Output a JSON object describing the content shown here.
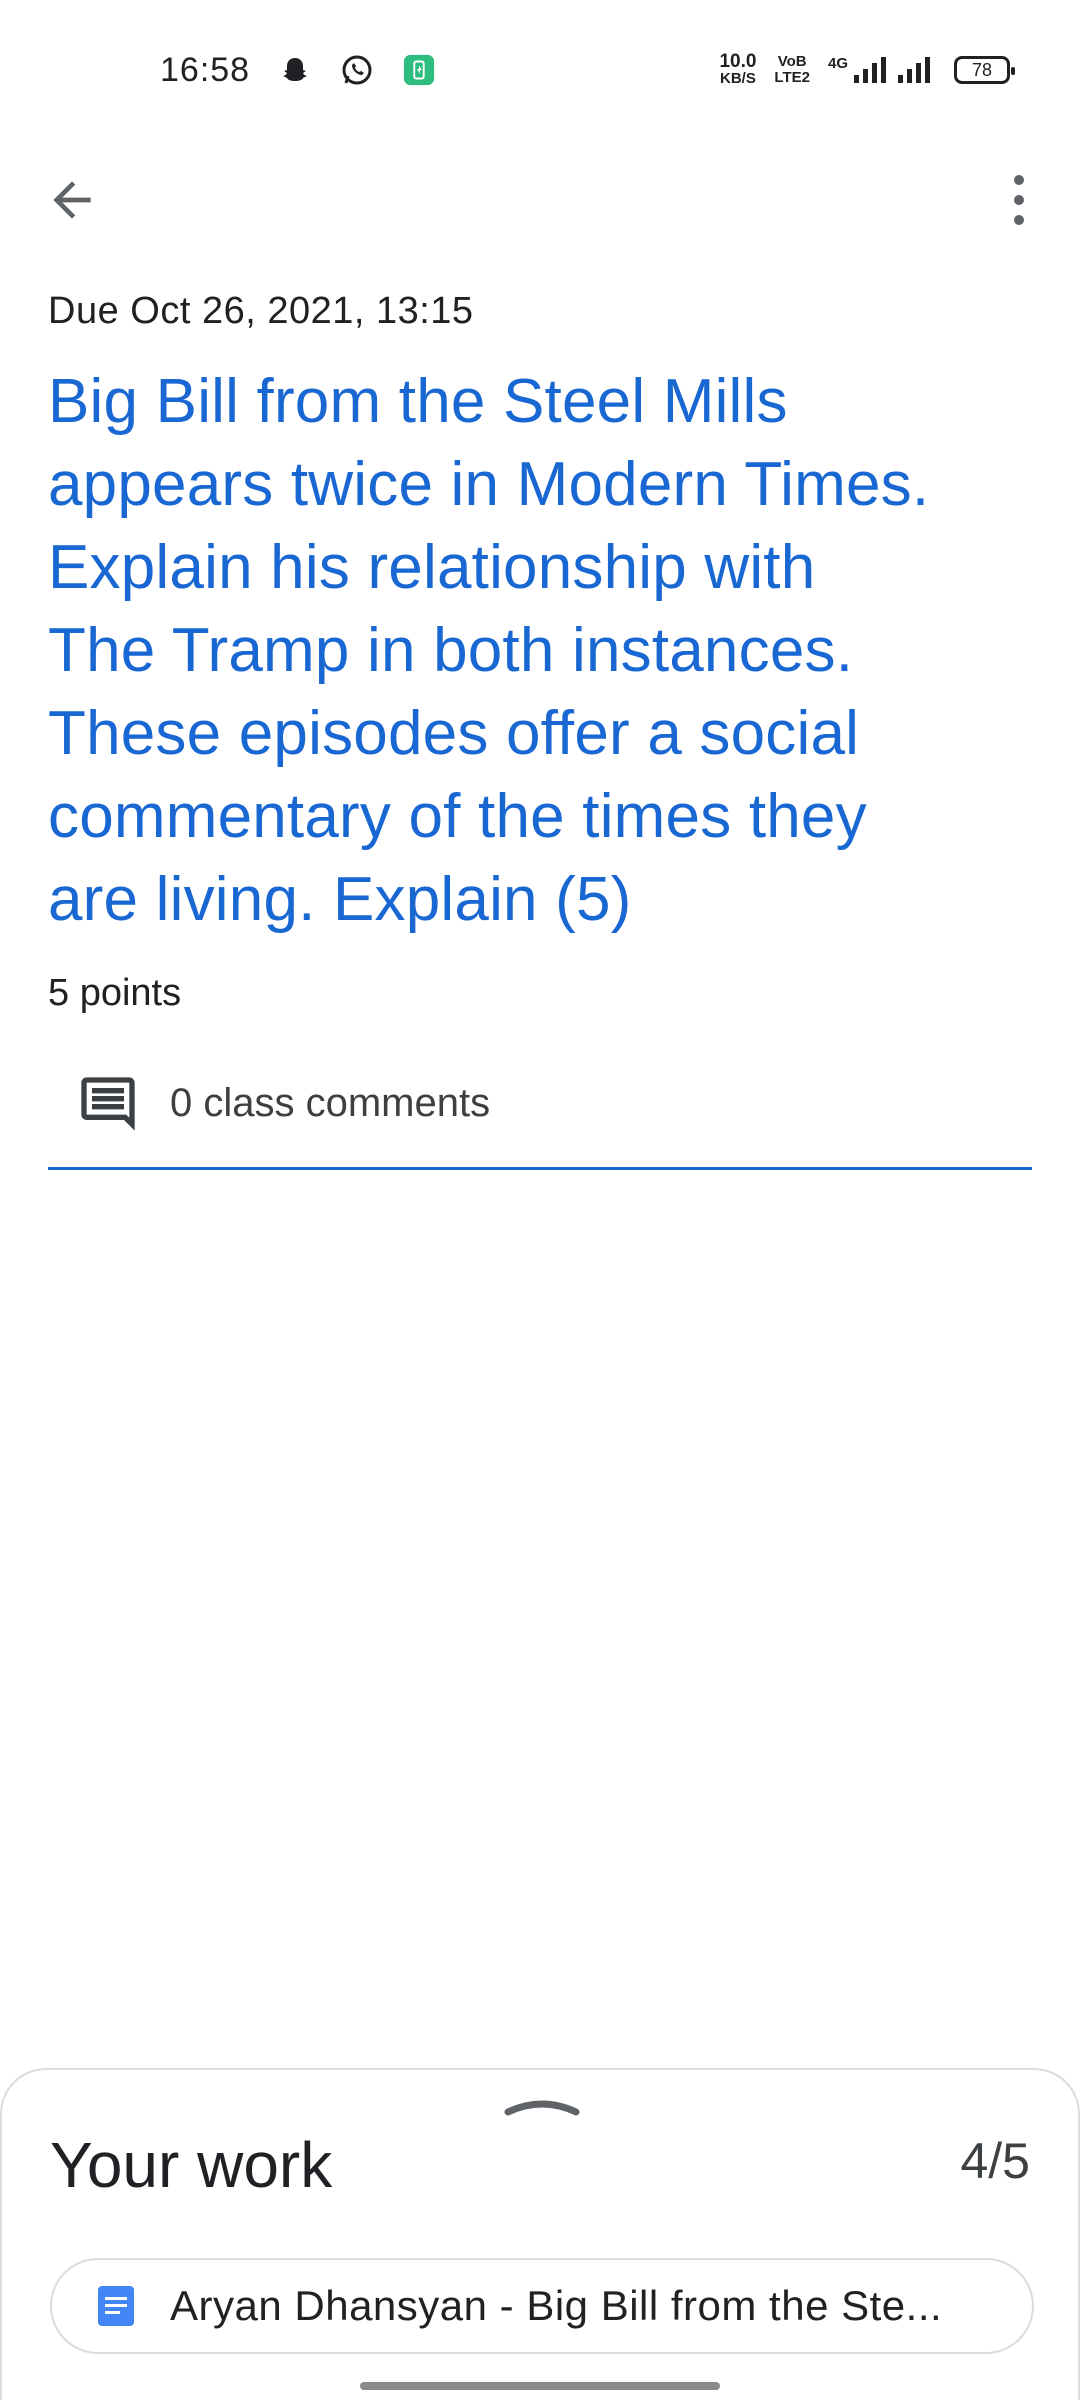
{
  "status_bar": {
    "time": "16:58",
    "net_speed_value": "10.0",
    "net_speed_unit": "KB/S",
    "volte_top": "VoB",
    "volte_bottom": "LTE2",
    "network_type": "4G",
    "battery": "78",
    "icons": [
      "snapchat-icon",
      "whatsapp-icon",
      "battery-saver-icon",
      "signal-icon",
      "battery-icon"
    ]
  },
  "app_bar": {
    "back_icon": "arrow-back-icon",
    "more_icon": "more-vert-icon"
  },
  "assignment": {
    "due": "Due Oct 26, 2021, 13:15",
    "title_lines": [
      "Big Bill from the Steel Mills",
      "appears twice in Modern Times.",
      "Explain his relationship with",
      "The Tramp in both instances.",
      "These episodes offer a social",
      "commentary of the times they",
      "are living. Explain (5)"
    ],
    "points": "5 points",
    "comments_label": "0 class comments",
    "comments_icon": "comment-icon"
  },
  "your_work": {
    "title": "Your work",
    "count": "4/5",
    "attachment_label": "Aryan Dhansyan - Big Bill from the Ste...",
    "attachment_icon": "google-docs-icon"
  },
  "colors": {
    "accent": "#1967d2",
    "docs_blue": "#4285f4",
    "green_badge": "#2dbd7e"
  }
}
